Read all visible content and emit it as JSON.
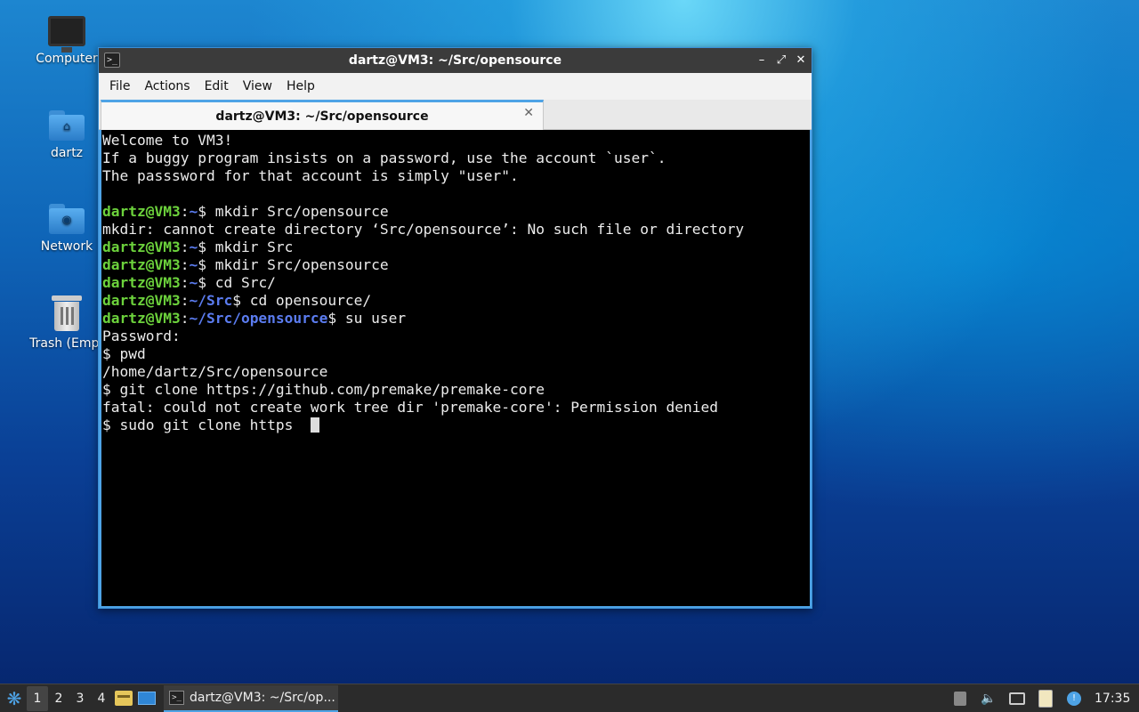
{
  "desktop": {
    "icons": [
      {
        "label": "Computer",
        "icon": "monitor-icon"
      },
      {
        "label": "dartz",
        "icon": "home-folder-icon"
      },
      {
        "label": "Network",
        "icon": "network-folder-icon"
      },
      {
        "label": "Trash (Empt",
        "icon": "trash-icon"
      }
    ]
  },
  "window": {
    "title": "dartz@VM3: ~/Src/opensource",
    "icon_glyph": ">_",
    "controls": {
      "minimize": "–",
      "maximize": "⤢",
      "close": "✕"
    },
    "menu": [
      "File",
      "Actions",
      "Edit",
      "View",
      "Help"
    ],
    "tab": {
      "label": "dartz@VM3: ~/Src/opensource",
      "close": "✕"
    }
  },
  "terminal": {
    "lines": [
      {
        "text": "Welcome to VM3!"
      },
      {
        "text": "If a buggy program insists on a password, use the account `user`."
      },
      {
        "text": "The passsword for that account is simply \"user\"."
      },
      {
        "text": ""
      },
      {
        "user": "dartz@VM3",
        "path": "~",
        "cmd": "$ mkdir Src/opensource"
      },
      {
        "text": "mkdir: cannot create directory ‘Src/opensource’: No such file or directory"
      },
      {
        "user": "dartz@VM3",
        "path": "~",
        "cmd": "$ mkdir Src"
      },
      {
        "user": "dartz@VM3",
        "path": "~",
        "cmd": "$ mkdir Src/opensource"
      },
      {
        "user": "dartz@VM3",
        "path": "~",
        "cmd": "$ cd Src/"
      },
      {
        "user": "dartz@VM3",
        "path": "~/Src",
        "cmd": "$ cd opensource/"
      },
      {
        "user": "dartz@VM3",
        "path": "~/Src/opensource",
        "cmd": "$ su user"
      },
      {
        "text": "Password:"
      },
      {
        "text": "$ pwd"
      },
      {
        "text": "/home/dartz/Src/opensource"
      },
      {
        "text": "$ git clone https://github.com/premake/premake-core"
      },
      {
        "text": "fatal: could not create work tree dir 'premake-core': Permission denied"
      },
      {
        "text": "$ sudo git clone https  ",
        "cursor": true
      }
    ],
    "colors": {
      "user": "#6cd23c",
      "path": "#5b7cf0",
      "background": "#000000",
      "text": "#ececec"
    }
  },
  "taskbar": {
    "workspaces": [
      "1",
      "2",
      "3",
      "4"
    ],
    "active_workspace": "1",
    "task_label": "dartz@VM3: ~/Src/op...",
    "clock": "17:35"
  }
}
